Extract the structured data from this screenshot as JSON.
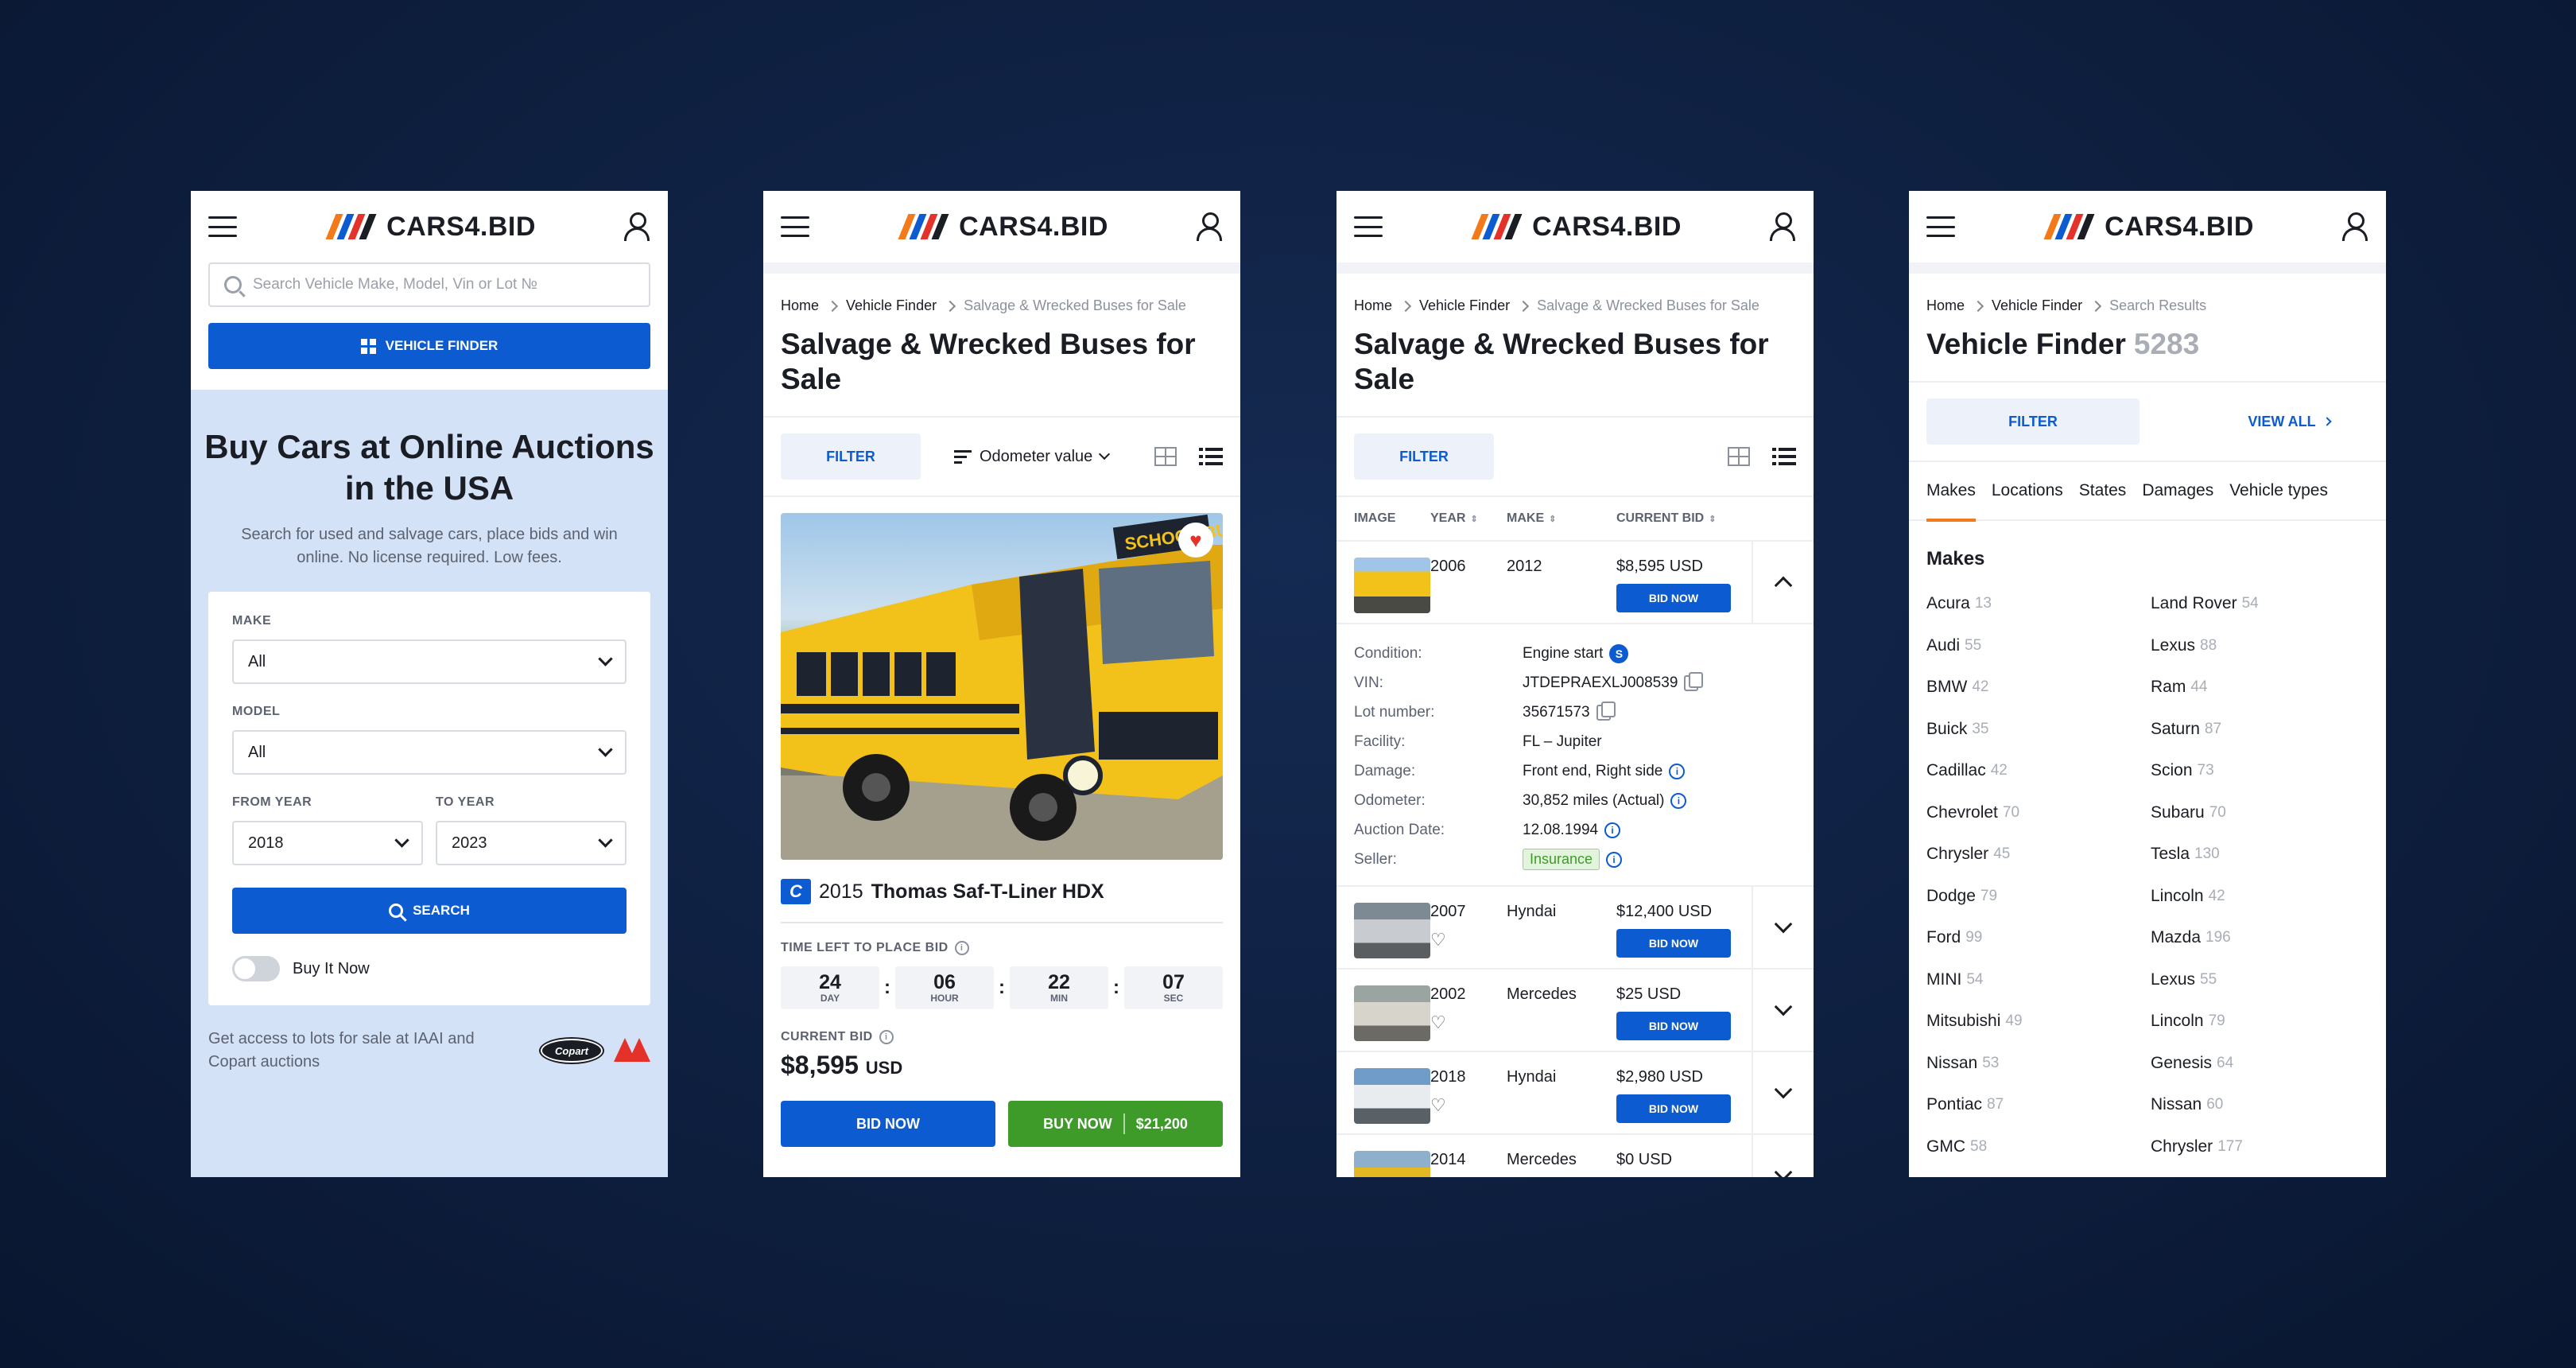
{
  "brand": {
    "logo_text": "CARS4.BID",
    "colors": {
      "primary": "#0d5bd1",
      "green": "#3e9b2a",
      "accent": "#f27a1a",
      "red": "#e4322b"
    }
  },
  "icons": {
    "menu": "hamburger-icon",
    "user": "user-icon",
    "search": "search-icon",
    "grid": "grid-icon"
  },
  "home": {
    "search_placeholder": "Search Vehicle Make, Model, Vin or Lot №",
    "vehicle_finder_label": "VEHICLE FINDER",
    "hero_title": "Buy Cars at Online Auctions in the USA",
    "hero_subtitle": "Search for used and salvage cars, place bids and win online. No license required. Low fees.",
    "form": {
      "make_label": "MAKE",
      "make_value": "All",
      "model_label": "MODEL",
      "model_value": "All",
      "from_year_label": "FROM YEAR",
      "from_year_value": "2018",
      "to_year_label": "TO YEAR",
      "to_year_value": "2023",
      "search_label": "SEARCH",
      "buy_it_now_label": "Buy It Now"
    },
    "footer_text": "Get access to lots for sale at IAAI and Copart auctions",
    "copart_logo": "Copart"
  },
  "listing": {
    "breadcrumb": [
      "Home",
      "Vehicle Finder",
      "Salvage & Wrecked Buses for Sale"
    ],
    "title": "Salvage & Wrecked Buses for Sale",
    "filter_label": "FILTER",
    "sort_label": "Odometer value",
    "vehicle": {
      "badge": "C",
      "year": "2015",
      "name": "Thomas Saf-T-Liner HDX",
      "bus_sign": "SCHOOL BUS"
    },
    "time_label": "TIME LEFT TO PLACE BID",
    "timer": [
      {
        "value": "24",
        "unit": "DAY"
      },
      {
        "value": "06",
        "unit": "HOUR"
      },
      {
        "value": "22",
        "unit": "MIN"
      },
      {
        "value": "07",
        "unit": "SEC"
      }
    ],
    "current_bid_label": "CURRENT BID",
    "current_bid": "$8,595",
    "currency": "USD",
    "bid_now_label": "BID NOW",
    "buy_now_label": "BUY NOW",
    "buy_now_price": "$21,200"
  },
  "table": {
    "breadcrumb": [
      "Home",
      "Vehicle Finder",
      "Salvage & Wrecked Buses for Sale"
    ],
    "title": "Salvage & Wrecked Buses for Sale",
    "filter_label": "FILTER",
    "headers": [
      "IMAGE",
      "YEAR",
      "MAKE",
      "CURRENT BID"
    ],
    "bid_label": "BID NOW",
    "rows": [
      {
        "year": "2006",
        "make": "2012",
        "bid": "$8,595 USD"
      },
      {
        "year": "2007",
        "make": "Hyndai",
        "bid": "$12,400 USD"
      },
      {
        "year": "2002",
        "make": "Mercedes",
        "bid": "$25 USD"
      },
      {
        "year": "2018",
        "make": "Hyndai",
        "bid": "$2,980 USD"
      },
      {
        "year": "2014",
        "make": "Mercedes",
        "bid": "$0 USD"
      }
    ],
    "details": [
      {
        "k": "Condition:",
        "v": "Engine start"
      },
      {
        "k": "VIN:",
        "v": "JTDEPRAEXLJ008539"
      },
      {
        "k": "Lot number:",
        "v": "35671573"
      },
      {
        "k": "Facility:",
        "v": "FL – Jupiter"
      },
      {
        "k": "Damage:",
        "v": "Front end, Right side"
      },
      {
        "k": "Odometer:",
        "v": "30,852 miles (Actual)"
      },
      {
        "k": "Auction Date:",
        "v": "12.08.1994"
      },
      {
        "k": "Seller:",
        "v": "Insurance"
      }
    ],
    "condition_badge": "S"
  },
  "finder": {
    "breadcrumb": [
      "Home",
      "Vehicle Finder",
      "Search Results"
    ],
    "title": "Vehicle Finder",
    "count": "5283",
    "filter_label": "FILTER",
    "view_all_label": "VIEW ALL",
    "tabs": [
      "Makes",
      "Locations",
      "States",
      "Damages",
      "Vehicle types"
    ],
    "makes_heading": "Makes",
    "makes": [
      {
        "name": "Acura",
        "n": "13"
      },
      {
        "name": "Land Rover",
        "n": "54"
      },
      {
        "name": "Audi",
        "n": "55"
      },
      {
        "name": "Lexus",
        "n": "88"
      },
      {
        "name": "BMW",
        "n": "42"
      },
      {
        "name": "Ram",
        "n": "44"
      },
      {
        "name": "Buick",
        "n": "35"
      },
      {
        "name": "Saturn",
        "n": "87"
      },
      {
        "name": "Cadillac",
        "n": "42"
      },
      {
        "name": "Scion",
        "n": "73"
      },
      {
        "name": "Chevrolet",
        "n": "70"
      },
      {
        "name": "Subaru",
        "n": "70"
      },
      {
        "name": "Chrysler",
        "n": "45"
      },
      {
        "name": "Tesla",
        "n": "130"
      },
      {
        "name": "Dodge",
        "n": "79"
      },
      {
        "name": "Lincoln",
        "n": "42"
      },
      {
        "name": "Ford",
        "n": "99"
      },
      {
        "name": "Mazda",
        "n": "196"
      },
      {
        "name": "MINI",
        "n": "54"
      },
      {
        "name": "Lexus",
        "n": "55"
      },
      {
        "name": "Mitsubishi",
        "n": "49"
      },
      {
        "name": "Lincoln",
        "n": "79"
      },
      {
        "name": "Nissan",
        "n": "53"
      },
      {
        "name": "Genesis",
        "n": "64"
      },
      {
        "name": "Pontiac",
        "n": "87"
      },
      {
        "name": "Nissan",
        "n": "60"
      },
      {
        "name": "GMC",
        "n": "58"
      },
      {
        "name": "Chrysler",
        "n": "177"
      }
    ]
  }
}
